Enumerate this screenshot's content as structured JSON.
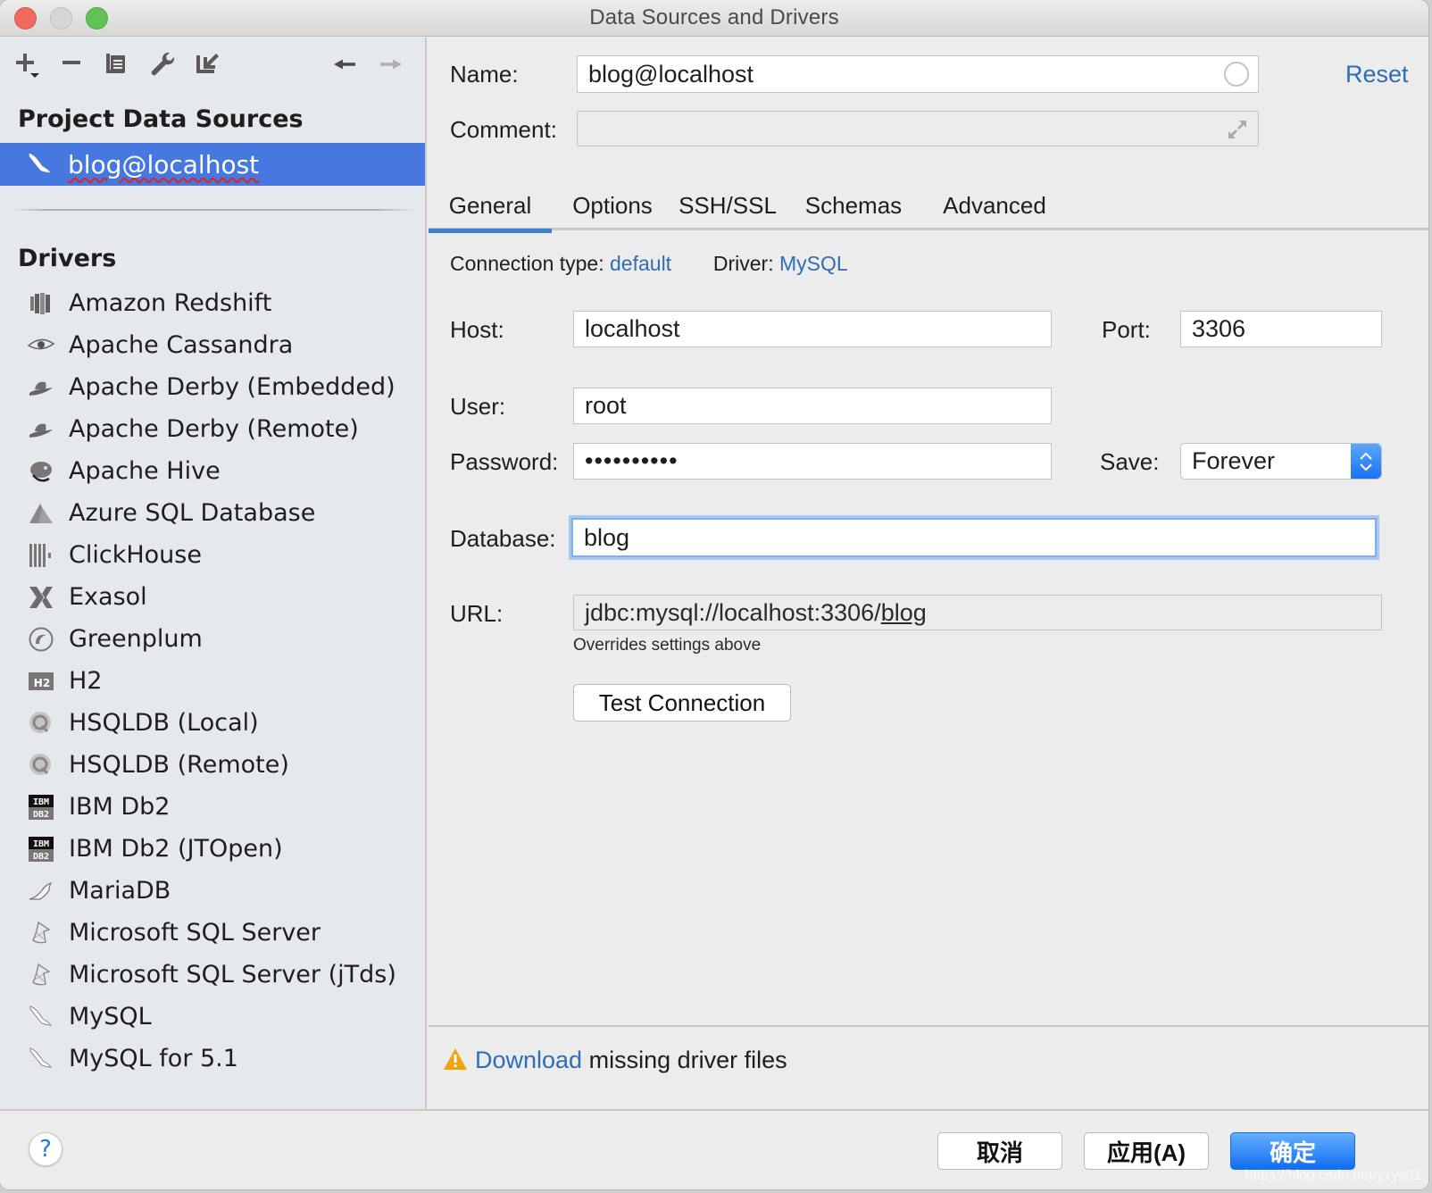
{
  "window": {
    "title": "Data Sources and Drivers"
  },
  "toolbar": {
    "add_icon": "plus-with-dropdown",
    "remove_icon": "minus",
    "duplicate_icon": "copy",
    "properties_icon": "wrench",
    "import_icon": "arrow-down-left",
    "back_icon": "arrow-left",
    "forward_icon": "arrow-right"
  },
  "sidebar": {
    "project_section_title": "Project Data Sources",
    "project_sources": [
      {
        "label": "blog@localhost",
        "icon": "mysql-dolphin",
        "selected": true
      }
    ],
    "drivers_section_title": "Drivers",
    "drivers": [
      {
        "label": "Amazon Redshift",
        "icon": "redshift"
      },
      {
        "label": "Apache Cassandra",
        "icon": "cassandra-eye"
      },
      {
        "label": "Apache Derby (Embedded)",
        "icon": "derby-hat"
      },
      {
        "label": "Apache Derby (Remote)",
        "icon": "derby-hat"
      },
      {
        "label": "Apache Hive",
        "icon": "hive"
      },
      {
        "label": "Azure SQL Database",
        "icon": "azure"
      },
      {
        "label": "ClickHouse",
        "icon": "clickhouse"
      },
      {
        "label": "Exasol",
        "icon": "exasol"
      },
      {
        "label": "Greenplum",
        "icon": "greenplum"
      },
      {
        "label": "H2",
        "icon": "h2"
      },
      {
        "label": "HSQLDB (Local)",
        "icon": "hsqldb"
      },
      {
        "label": "HSQLDB (Remote)",
        "icon": "hsqldb"
      },
      {
        "label": "IBM Db2",
        "icon": "ibm-db2"
      },
      {
        "label": "IBM Db2 (JTOpen)",
        "icon": "ibm-db2"
      },
      {
        "label": "MariaDB",
        "icon": "mariadb-seal"
      },
      {
        "label": "Microsoft SQL Server",
        "icon": "mssql"
      },
      {
        "label": "Microsoft SQL Server (jTds)",
        "icon": "mssql"
      },
      {
        "label": "MySQL",
        "icon": "mysql-dolphin"
      },
      {
        "label": "MySQL for 5.1",
        "icon": "mysql-dolphin"
      }
    ]
  },
  "form": {
    "name_label": "Name:",
    "name_value": "blog@localhost",
    "reset_link": "Reset",
    "comment_label": "Comment:",
    "comment_value": "",
    "tabs": [
      {
        "label": "General",
        "active": true
      },
      {
        "label": "Options",
        "active": false
      },
      {
        "label": "SSH/SSL",
        "active": false
      },
      {
        "label": "Schemas",
        "active": false
      },
      {
        "label": "Advanced",
        "active": false
      }
    ],
    "connection_type_label": "Connection type:",
    "connection_type_value": "default",
    "driver_label": "Driver:",
    "driver_value": "MySQL",
    "host_label": "Host:",
    "host_value": "localhost",
    "port_label": "Port:",
    "port_value": "3306",
    "user_label": "User:",
    "user_value": "root",
    "password_label": "Password:",
    "password_value": "••••••••••",
    "save_label": "Save:",
    "save_value": "Forever",
    "database_label": "Database:",
    "database_value": "blog",
    "url_label": "URL:",
    "url_prefix": "jdbc:mysql://localhost:3306/",
    "url_db": "blog",
    "url_hint": "Overrides settings above",
    "test_connection_button": "Test Connection"
  },
  "notice": {
    "download_link": "Download",
    "message": " missing driver files"
  },
  "footer": {
    "help": "?",
    "cancel_button": "取消",
    "apply_button": "应用(A)",
    "ok_button": "确定",
    "watermark": "https://blog.csdn.net/yxys01"
  },
  "colors": {
    "selection": "#4778e0",
    "link": "#2f6db5",
    "primary_button": "#1a74f0",
    "focus_ring": "#97c0f2",
    "warning": "#f0a30a"
  }
}
